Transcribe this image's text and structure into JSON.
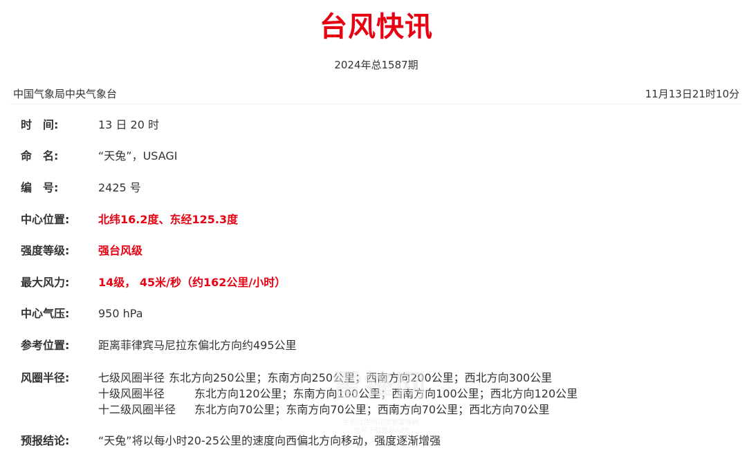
{
  "title": "台风快讯",
  "issue": "2024年总1587期",
  "source": "中国气象局中央气象台",
  "publish_time": "11月13日21时10分",
  "fields": {
    "time": {
      "label": "时　间:",
      "value": "13 日 20 时"
    },
    "name": {
      "label": "命　名:",
      "value": "“天兔”，USAGI"
    },
    "number": {
      "label": "编　号:",
      "value": "2425 号"
    },
    "center_position": {
      "label": "中心位置:",
      "value": "北纬16.2度、东经125.3度"
    },
    "intensity_level": {
      "label": "强度等级:",
      "value": "强台风级"
    },
    "max_wind": {
      "label": "最大风力:",
      "value": "14级， 45米/秒（约162公里/小时）"
    },
    "center_pressure": {
      "label": "中心气压:",
      "value": "950 hPa"
    },
    "reference_position": {
      "label": "参考位置:",
      "value": "距离菲律宾马尼拉东偏北方向约495公里"
    },
    "wind_radius": {
      "label": "风圈半径:",
      "lines": [
        {
          "level": "七级风圈半径",
          "text": "东北方向250公里；东南方向250公里；西南方向200公里；西北方向300公里"
        },
        {
          "level": "十级风圈半径",
          "text": "东北方向120公里；东南方向100公里；西南方向100公里；西北方向120公里"
        },
        {
          "level": "十二级风圈半径",
          "text": "东北方向70公里；东南方向70公里；西南方向70公里；西北方向70公里"
        }
      ]
    },
    "forecast": {
      "label": "预报结论:",
      "value": "“天兔”将以每小时20-25公里的速度向西偏北方向移动，强度逐渐增强"
    }
  },
  "watermark": {
    "main": "雷锋网",
    "line1": "手机应用商店搜索雷锋网",
    "line2": "也可下载最新APP"
  },
  "colors": {
    "accent": "#e60012",
    "text": "#333333"
  }
}
